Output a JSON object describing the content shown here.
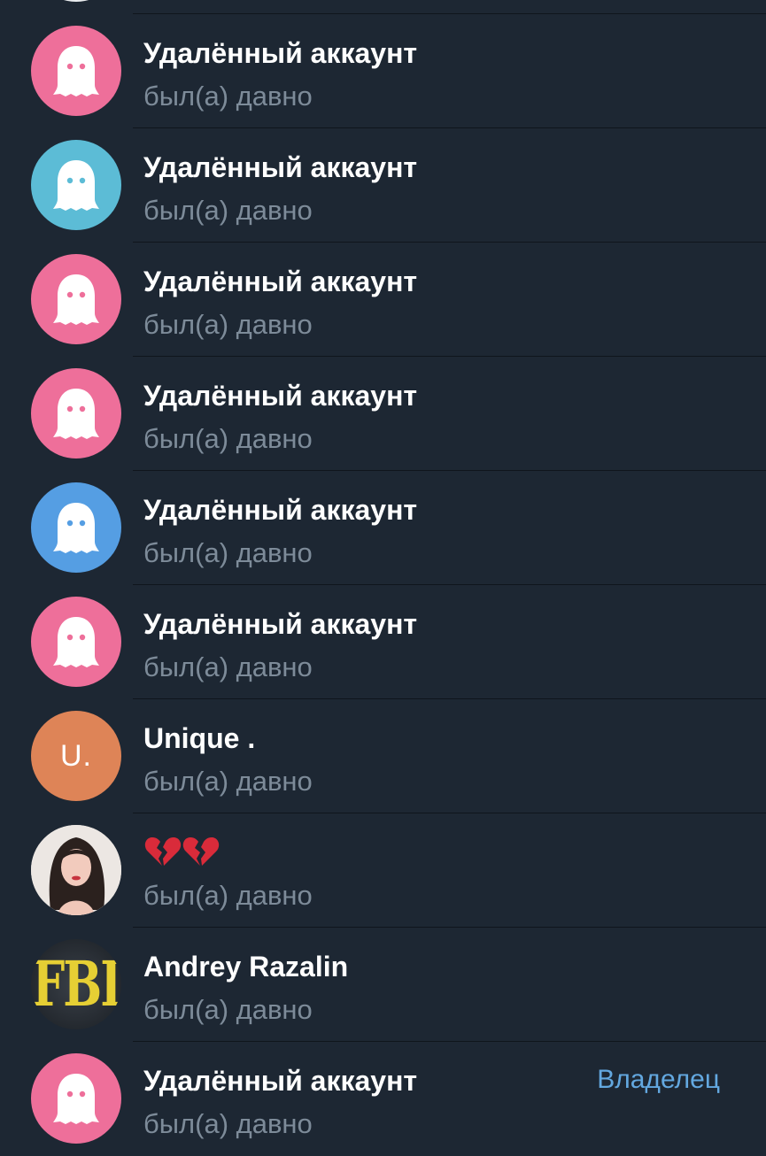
{
  "members": [
    {
      "name": "",
      "status": "",
      "avatar": {
        "type": "ghost",
        "color": "#e9ecef"
      },
      "role": ""
    },
    {
      "name": "Удалённый аккаунт",
      "status": "был(а) давно",
      "avatar": {
        "type": "ghost",
        "color": "#ee6f9a"
      },
      "role": ""
    },
    {
      "name": "Удалённый аккаунт",
      "status": "был(а) давно",
      "avatar": {
        "type": "ghost",
        "color": "#5cbcd6"
      },
      "role": ""
    },
    {
      "name": "Удалённый аккаунт",
      "status": "был(а) давно",
      "avatar": {
        "type": "ghost",
        "color": "#ee6f9a"
      },
      "role": ""
    },
    {
      "name": "Удалённый аккаунт",
      "status": "был(а) давно",
      "avatar": {
        "type": "ghost",
        "color": "#ee6f9a"
      },
      "role": ""
    },
    {
      "name": "Удалённый аккаунт",
      "status": "был(а) давно",
      "avatar": {
        "type": "ghost",
        "color": "#559ee3"
      },
      "role": ""
    },
    {
      "name": "Удалённый аккаунт",
      "status": "был(а) давно",
      "avatar": {
        "type": "ghost",
        "color": "#ee6f9a"
      },
      "role": ""
    },
    {
      "name": "Unique .",
      "status": "был(а) давно",
      "avatar": {
        "type": "initials",
        "text": "U.",
        "color": "#de8457"
      },
      "role": ""
    },
    {
      "name": "💔💔",
      "status": "был(а) давно",
      "avatar": {
        "type": "photo",
        "color": "#e8e2de"
      },
      "role": ""
    },
    {
      "name": "Andrey Razalin",
      "status": "был(а) давно",
      "avatar": {
        "type": "fbi",
        "text": "FBI",
        "color": "#2a2f35"
      },
      "role": ""
    },
    {
      "name": "Удалённый аккаунт",
      "status": "был(а) давно",
      "avatar": {
        "type": "ghost",
        "color": "#ee6f9a"
      },
      "role": "Владелец"
    }
  ]
}
